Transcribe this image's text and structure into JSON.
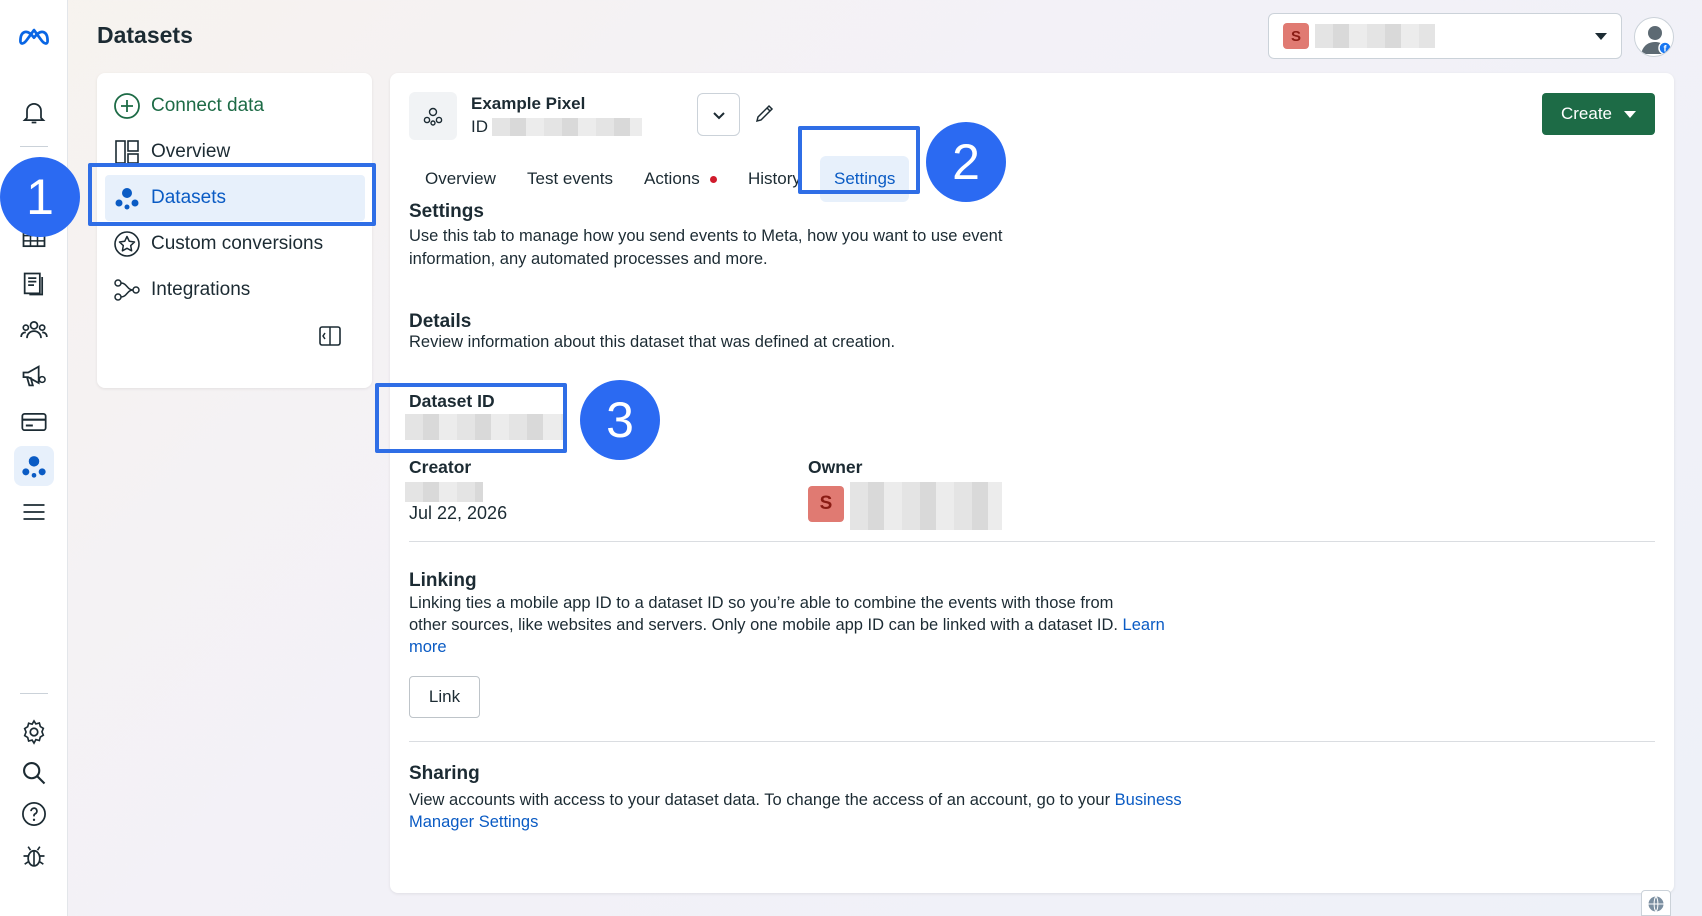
{
  "app": {
    "page_title": "Datasets",
    "account_badge": "S"
  },
  "left_nav": {
    "items": [
      {
        "label": "Connect data",
        "icon": "plus-circle-icon"
      },
      {
        "label": "Overview",
        "icon": "layout-icon"
      },
      {
        "label": "Datasets",
        "icon": "datasets-icon",
        "active": true
      },
      {
        "label": "Custom conversions",
        "icon": "star-badge-icon"
      },
      {
        "label": "Integrations",
        "icon": "integrations-icon"
      }
    ]
  },
  "dataset": {
    "name": "Example Pixel",
    "id_label": "ID"
  },
  "tabs": [
    {
      "label": "Overview"
    },
    {
      "label": "Test events"
    },
    {
      "label": "Actions",
      "has_alert": true
    },
    {
      "label": "History"
    },
    {
      "label": "Settings",
      "active": true
    }
  ],
  "create_button": "Create",
  "settings": {
    "title": "Settings",
    "description_line1": "Use this tab to manage how you send events to Meta, how you want to use event",
    "description_line2": "information, any automated processes and more."
  },
  "details": {
    "title": "Details",
    "description": "Review information about this dataset that was defined at creation.",
    "dataset_id_label": "Dataset ID",
    "creator_label": "Creator",
    "creator_date": "Jul 22, 2026",
    "owner_label": "Owner",
    "owner_badge": "S"
  },
  "linking": {
    "title": "Linking",
    "line1": "Linking ties a mobile app ID to a dataset ID so you’re able to combine the events with those from",
    "line2": "other sources, like websites and servers. Only one mobile app ID can be linked with a dataset ID.",
    "learn": "Learn",
    "more": "more",
    "button": "Link"
  },
  "sharing": {
    "title": "Sharing",
    "line1": "View accounts with access to your dataset data. To change the access of an account, go to your",
    "link1": "Business",
    "link2": "Manager Settings"
  },
  "markers": [
    "1",
    "2",
    "3"
  ],
  "colors": {
    "accent_blue": "#0a5bc4",
    "highlight_blue": "#2f6ee6",
    "create_green": "#1d6b46",
    "alert_red": "#d01b2c"
  }
}
